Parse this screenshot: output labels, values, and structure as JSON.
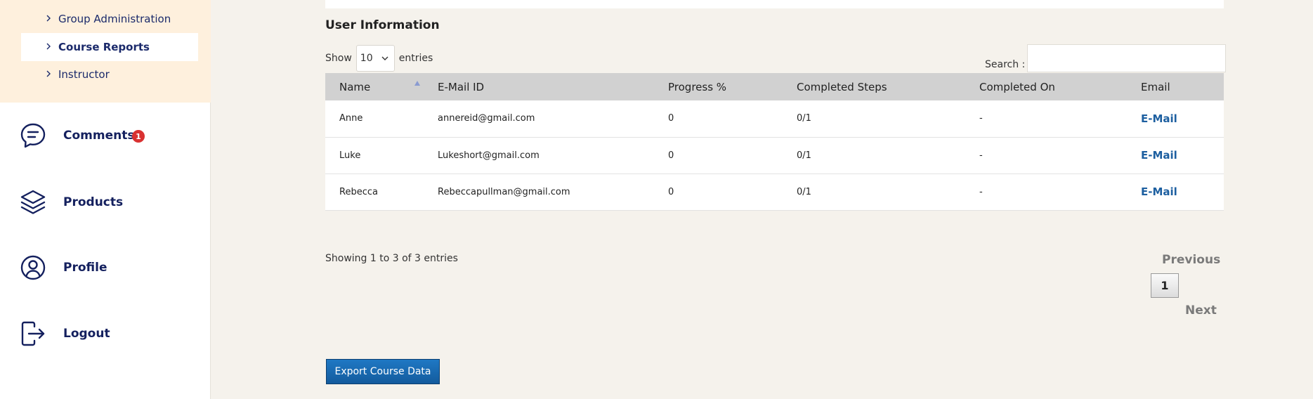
{
  "sidebar": {
    "submenu": [
      {
        "label": "Group Administration"
      },
      {
        "label": "Course Reports"
      },
      {
        "label": "Instructor"
      }
    ],
    "nav": [
      {
        "label": "Comments",
        "icon": "comment-icon",
        "badge": "1"
      },
      {
        "label": "Products",
        "icon": "layers-icon"
      },
      {
        "label": "Profile",
        "icon": "user-icon"
      },
      {
        "label": "Logout",
        "icon": "logout-icon"
      }
    ]
  },
  "main": {
    "section_title": "User Information",
    "show_label": "Show",
    "entries_value": "10",
    "entries_label": "entries",
    "search_label": "Search :",
    "search_value": "",
    "table": {
      "columns": [
        "Name",
        "E-Mail ID",
        "Progress %",
        "Completed Steps",
        "Completed On",
        "Email"
      ],
      "rows": [
        [
          "Anne",
          "annereid@gmail.com",
          "0",
          "0/1",
          "-",
          "E-Mail"
        ],
        [
          "Luke",
          "Lukeshort@gmail.com",
          "0",
          "0/1",
          "-",
          "E-Mail"
        ],
        [
          "Rebecca",
          "Rebeccapullman@gmail.com",
          "0",
          "0/1",
          "-",
          "E-Mail"
        ]
      ]
    },
    "showing_text": "Showing 1 to 3 of 3 entries",
    "pager": {
      "prev": "Previous",
      "page": "1",
      "next": "Next"
    },
    "export_label": "Export Course Data"
  },
  "colors": {
    "accent": "#14205e",
    "badge": "#d93131",
    "link": "#1d5fa0",
    "button": "#1f78c4",
    "submenu_bg": "#fef0dd",
    "page_bg": "#f5f2ec"
  }
}
